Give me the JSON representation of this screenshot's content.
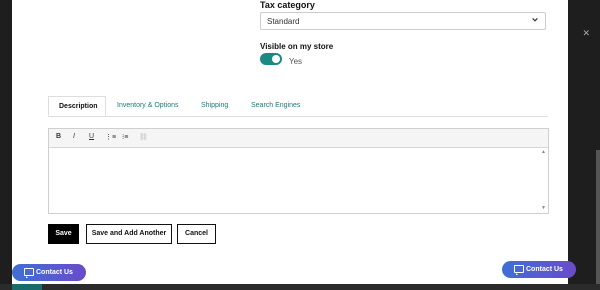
{
  "tax": {
    "label": "Tax category",
    "value": "Standard"
  },
  "visibility": {
    "label": "Visible on my store",
    "value": "Yes"
  },
  "tabs": [
    {
      "label": "Description"
    },
    {
      "label": "Inventory & Options"
    },
    {
      "label": "Shipping"
    },
    {
      "label": "Search Engines"
    }
  ],
  "editor": {
    "toolbar": {
      "bold": "B",
      "italic": "I",
      "underline": "U"
    }
  },
  "actions": {
    "save": "Save",
    "save_another": "Save and Add Another",
    "cancel": "Cancel"
  },
  "contact": {
    "label": "Contact Us"
  },
  "colors": {
    "toggle": "#1b8a83",
    "tab_link": "#1b7a7a",
    "contact_gradient_start": "#3f6fd6",
    "contact_gradient_end": "#6a4bc9"
  }
}
